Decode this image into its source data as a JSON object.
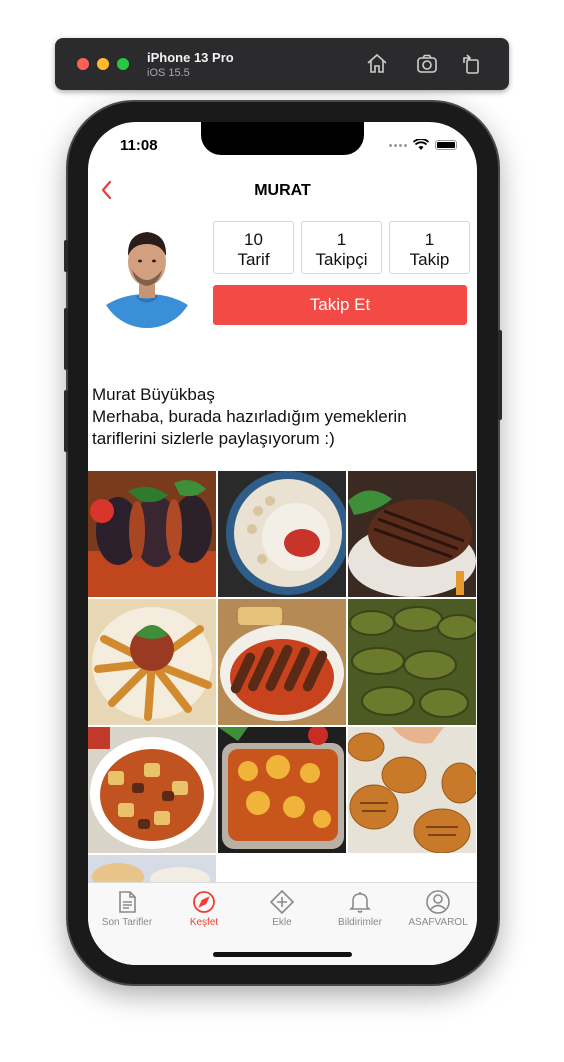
{
  "simulator": {
    "device_name": "iPhone 13 Pro",
    "os_version": "iOS 15.5",
    "toolbar_icons": [
      "home-icon",
      "screenshot-icon",
      "rotate-icon"
    ]
  },
  "status_bar": {
    "time": "11:08"
  },
  "nav": {
    "title": "MURAT",
    "back_icon": "chevron-left-icon"
  },
  "profile": {
    "stats": [
      {
        "value": "10",
        "label": "Tarif"
      },
      {
        "value": "1",
        "label": "Takipçi"
      },
      {
        "value": "1",
        "label": "Takip"
      }
    ],
    "follow_label": "Takip Et",
    "name": "Murat Büyükbaş",
    "bio": "Merhaba, burada hazırladığım yemeklerin tariflerini sizlerle paylaşıyorum :)"
  },
  "recipes": [
    "eggplant-kebab-photo",
    "manti-photo",
    "grilled-steak-photo",
    "borek-rolls-photo",
    "kofte-kebab-photo",
    "stuffed-grape-leaves-photo",
    "meat-potato-stew-photo",
    "casserole-photo",
    "bread-rolls-photo",
    "bread-photo"
  ],
  "tabbar": {
    "items": [
      {
        "label": "Son Tarifler",
        "icon": "document-icon",
        "active": false
      },
      {
        "label": "Keşfet",
        "icon": "compass-icon",
        "active": true
      },
      {
        "label": "Ekle",
        "icon": "add-diamond-icon",
        "active": false
      },
      {
        "label": "Bildirimler",
        "icon": "bell-icon",
        "active": false
      },
      {
        "label": "ASAFVAROL",
        "icon": "user-circle-icon",
        "active": false
      }
    ]
  },
  "colors": {
    "accent": "#f24a44",
    "tab_active": "#f04035"
  }
}
